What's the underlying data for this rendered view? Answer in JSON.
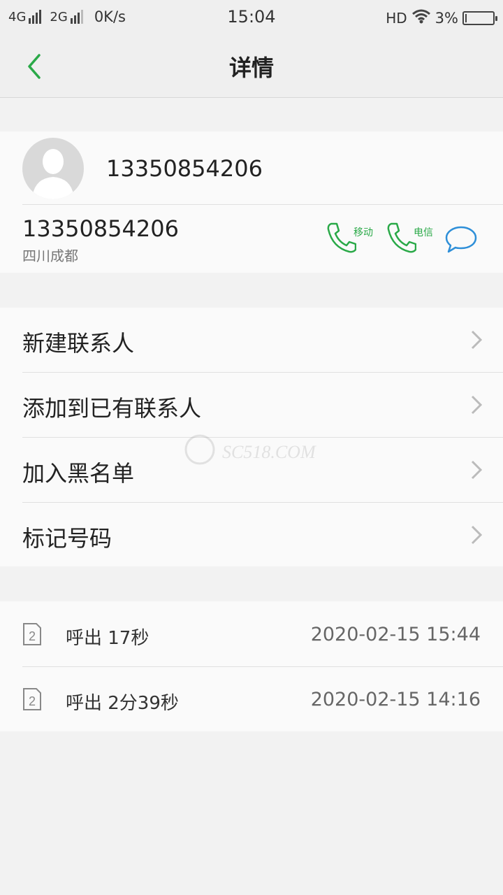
{
  "status": {
    "net1": "4G",
    "net2": "2G",
    "speed": "0K/s",
    "time": "15:04",
    "hd": "HD",
    "battery_pct": "3%",
    "battery_level": 0.03
  },
  "header": {
    "title": "详情",
    "back_icon": "chevron-left-icon"
  },
  "contact": {
    "name": "13350854206",
    "number": "13350854206",
    "location": "四川成都",
    "call_mobile_label": "移动",
    "call_telecom_label": "电信",
    "accent": "#2aa948",
    "message_color": "#2e8fd8"
  },
  "menu": {
    "items": [
      {
        "label": "新建联系人"
      },
      {
        "label": "添加到已有联系人"
      },
      {
        "label": "加入黑名单"
      },
      {
        "label": "标记号码"
      }
    ]
  },
  "call_log": [
    {
      "type": "呼出 17秒",
      "datetime": "2020-02-15 15:44",
      "sim": "2"
    },
    {
      "type": "呼出 2分39秒",
      "datetime": "2020-02-15 14:16",
      "sim": "2"
    }
  ],
  "watermark": {
    "text": "SC518.COM"
  }
}
